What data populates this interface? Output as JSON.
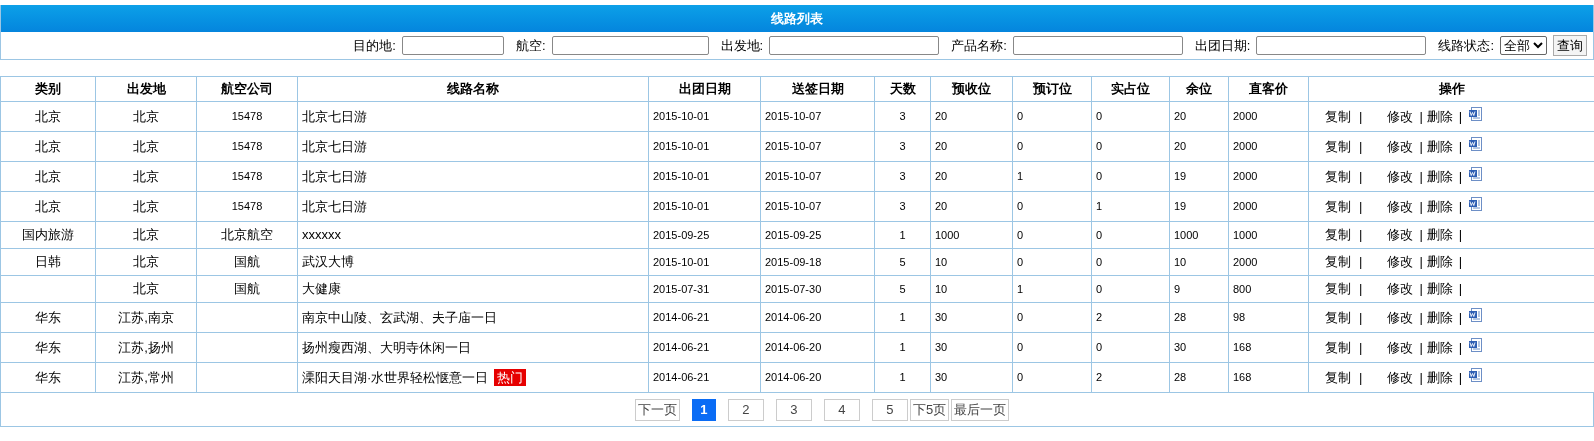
{
  "title": "线路列表",
  "filters": [
    {
      "label": "目的地:",
      "kind": "text"
    },
    {
      "label": "航空:",
      "kind": "text"
    },
    {
      "label": "出发地:",
      "kind": "text"
    },
    {
      "label": "产品名称:",
      "kind": "text"
    },
    {
      "label": "出团日期:",
      "kind": "text"
    },
    {
      "label": "线路状态:",
      "kind": "select",
      "value": "全部"
    }
  ],
  "search_button": "查询",
  "table": {
    "columns": [
      "类别",
      "出发地",
      "航空公司",
      "线路名称",
      "出团日期",
      "送签日期",
      "天数",
      "预收位",
      "预订位",
      "实占位",
      "余位",
      "直客价",
      "操作"
    ],
    "rows": [
      {
        "cells": [
          "北京",
          "北京",
          "15478",
          "北京七日游",
          "2015-10-01",
          "2015-10-07",
          "3",
          "20",
          "0",
          "0",
          "20",
          "2000"
        ],
        "actions": [
          {
            "label": "复制",
            "separator": "|"
          },
          {
            "label": "修改",
            "separator": "|"
          },
          {
            "label": "删除",
            "separator": "|"
          }
        ],
        "has_doc": true
      },
      {
        "cells": [
          "北京",
          "北京",
          "15478",
          "北京七日游",
          "2015-10-01",
          "2015-10-07",
          "3",
          "20",
          "0",
          "0",
          "20",
          "2000"
        ],
        "actions": [
          {
            "label": "复制",
            "separator": "|"
          },
          {
            "label": "修改",
            "separator": "|"
          },
          {
            "label": "删除",
            "separator": "|"
          }
        ],
        "has_doc": true
      },
      {
        "cells": [
          "北京",
          "北京",
          "15478",
          "北京七日游",
          "2015-10-01",
          "2015-10-07",
          "3",
          "20",
          "1",
          "0",
          "19",
          "2000"
        ],
        "actions": [
          {
            "label": "复制",
            "separator": "|"
          },
          {
            "label": "修改",
            "separator": "|"
          },
          {
            "label": "删除",
            "separator": "|"
          }
        ],
        "has_doc": true
      },
      {
        "cells": [
          "北京",
          "北京",
          "15478",
          "北京七日游",
          "2015-10-01",
          "2015-10-07",
          "3",
          "20",
          "0",
          "1",
          "19",
          "2000"
        ],
        "actions": [
          {
            "label": "复制",
            "separator": "|"
          },
          {
            "label": "修改",
            "separator": "|"
          },
          {
            "label": "删除",
            "separator": "|"
          }
        ],
        "has_doc": true
      },
      {
        "cells": [
          "国内旅游",
          "北京",
          "北京航空",
          "xxxxxx",
          "2015-09-25",
          "2015-09-25",
          "1",
          "1000",
          "0",
          "0",
          "1000",
          "1000"
        ],
        "actions": [
          {
            "label": "复制",
            "separator": "|"
          },
          {
            "label": "修改",
            "separator": "|"
          },
          {
            "label": "删除",
            "separator": "|"
          }
        ],
        "has_doc": false
      },
      {
        "cells": [
          "日韩",
          "北京",
          "国航",
          "武汉大博",
          "2015-10-01",
          "2015-09-18",
          "5",
          "10",
          "0",
          "0",
          "10",
          "2000"
        ],
        "actions": [
          {
            "label": "复制",
            "separator": "|"
          },
          {
            "label": "修改",
            "separator": "|"
          },
          {
            "label": "删除",
            "separator": "|"
          }
        ],
        "has_doc": false
      },
      {
        "cells": [
          "",
          "北京",
          "国航",
          "大健康",
          "2015-07-31",
          "2015-07-30",
          "5",
          "10",
          "1",
          "0",
          "9",
          "800"
        ],
        "actions": [
          {
            "label": "复制",
            "separator": "|"
          },
          {
            "label": "修改",
            "separator": "|"
          },
          {
            "label": "删除",
            "separator": "|"
          }
        ],
        "has_doc": false
      },
      {
        "cells": [
          "华东",
          "江苏,南京",
          "",
          "南京中山陵、玄武湖、夫子庙一日",
          "2014-06-21",
          "2014-06-20",
          "1",
          "30",
          "0",
          "2",
          "28",
          "98"
        ],
        "actions": [
          {
            "label": "复制",
            "separator": "|"
          },
          {
            "label": "修改",
            "separator": "|"
          },
          {
            "label": "删除",
            "separator": "|"
          }
        ],
        "has_doc": true
      },
      {
        "cells": [
          "华东",
          "江苏,扬州",
          "",
          "扬州瘦西湖、大明寺休闲一日",
          "2014-06-21",
          "2014-06-20",
          "1",
          "30",
          "0",
          "0",
          "30",
          "168"
        ],
        "actions": [
          {
            "label": "复制",
            "separator": "|"
          },
          {
            "label": "修改",
            "separator": "|"
          },
          {
            "label": "删除",
            "separator": "|"
          }
        ],
        "has_doc": true
      },
      {
        "cells": [
          "华东",
          "江苏,常州",
          "",
          "溧阳天目湖·水世界轻松惬意一日",
          "2014-06-21",
          "2014-06-20",
          "1",
          "30",
          "0",
          "2",
          "28",
          "168"
        ],
        "badge": "热门",
        "actions": [
          {
            "label": "复制",
            "separator": "|"
          },
          {
            "label": "修改",
            "separator": "|"
          },
          {
            "label": "删除",
            "separator": "|"
          }
        ],
        "has_doc": true
      }
    ]
  },
  "pagination": {
    "prev": "下一页",
    "pages": [
      {
        "label": "1",
        "selected": true
      },
      {
        "label": "2",
        "selected": false
      },
      {
        "label": "3",
        "selected": false
      },
      {
        "label": "4",
        "selected": false
      },
      {
        "label": "5",
        "selected": false
      }
    ],
    "next_five": "下5页",
    "last": "最后一页"
  }
}
